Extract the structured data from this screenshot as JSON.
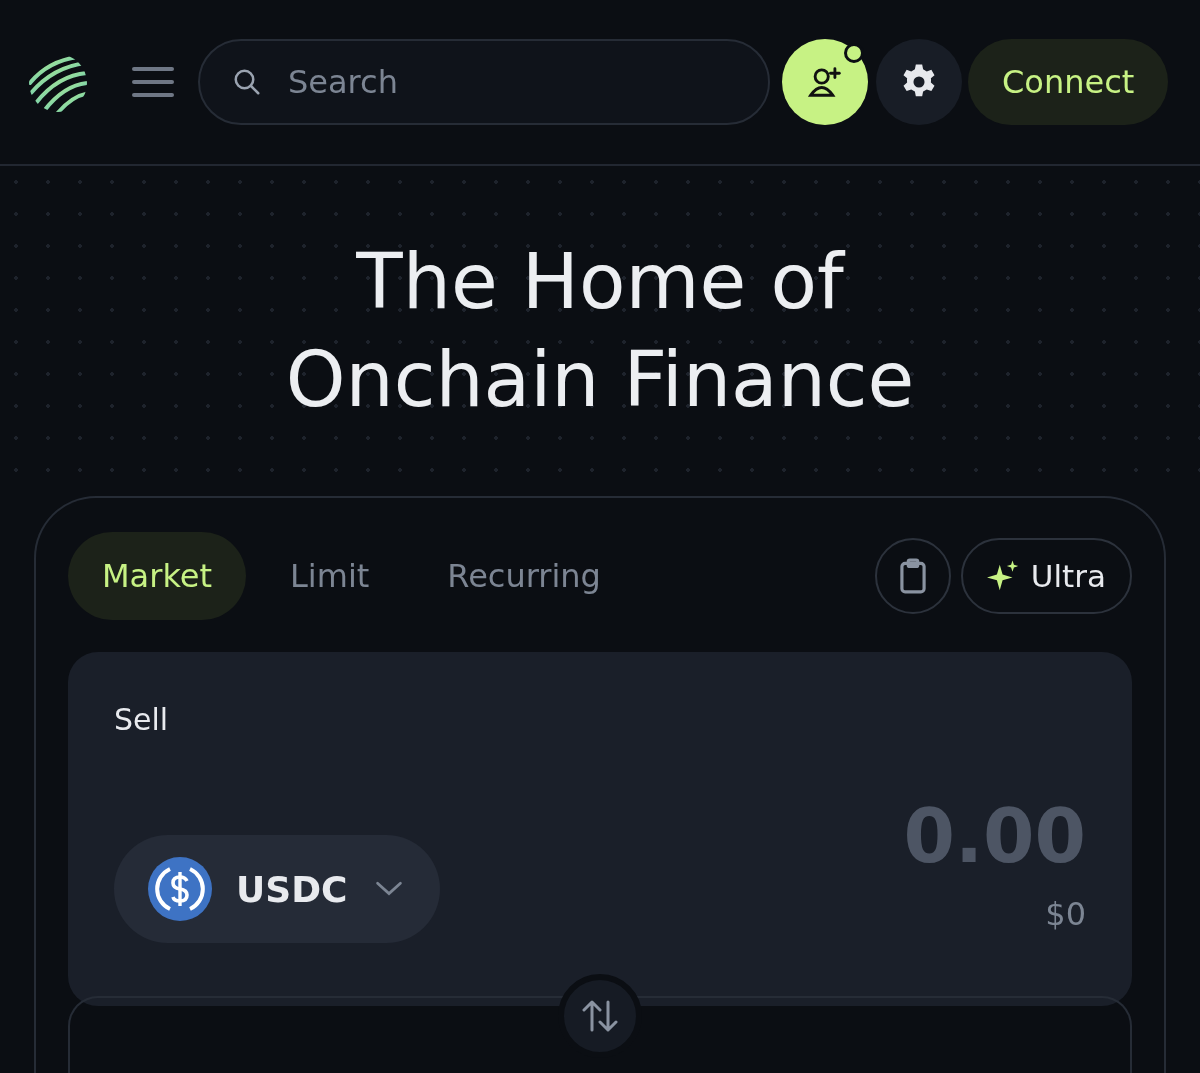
{
  "header": {
    "search": {
      "placeholder": "Search"
    },
    "notification_dot": true,
    "connect_label": "Connect"
  },
  "hero": {
    "title_lines": [
      "The Home of",
      "Onchain Finance"
    ]
  },
  "swap": {
    "tabs": [
      {
        "label": "Market",
        "selected": true
      },
      {
        "label": "Limit",
        "selected": false
      },
      {
        "label": "Recurring",
        "selected": false
      }
    ],
    "ultra_label": "Ultra",
    "sell": {
      "label": "Sell",
      "token": "USDC",
      "amount_placeholder": "0.00",
      "value": "$0"
    }
  }
}
